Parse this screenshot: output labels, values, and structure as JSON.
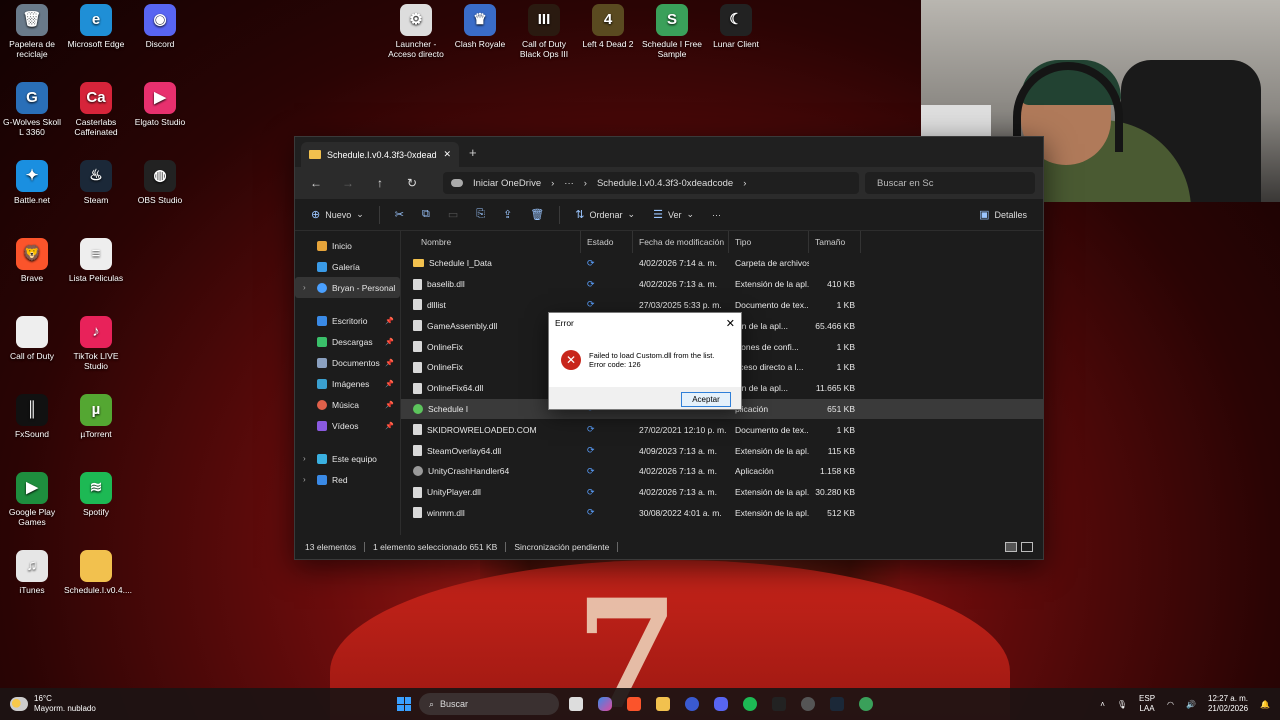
{
  "desktop_icons": [
    {
      "label": "Papelera de reciclaje",
      "color": "#6a7a8a",
      "glyph": "🗑"
    },
    {
      "label": "Microsoft Edge",
      "color": "#1f8fd6",
      "glyph": "e"
    },
    {
      "label": "Discord",
      "color": "#5865f2",
      "glyph": "◉"
    },
    {
      "label": "G-Wolves Skoll L 3360",
      "color": "#2a6fb8",
      "glyph": "G"
    },
    {
      "label": "Casterlabs Caffeinated",
      "color": "#d6243a",
      "glyph": "Ca"
    },
    {
      "label": "Elgato Studio",
      "color": "#e8306e",
      "glyph": "▶"
    },
    {
      "label": "Battle.net",
      "color": "#1a8fe0",
      "glyph": "✦"
    },
    {
      "label": "Steam",
      "color": "#1b2838",
      "glyph": "♨"
    },
    {
      "label": "OBS Studio",
      "color": "#222",
      "glyph": "◍"
    },
    {
      "label": "Brave",
      "color": "#fb542b",
      "glyph": "🦁"
    },
    {
      "label": "Lista Peliculas",
      "color": "#eee",
      "glyph": "≡"
    },
    {
      "label": "Call of Duty",
      "color": "#eee",
      "glyph": ""
    },
    {
      "label": "TikTok LIVE Studio",
      "color": "#e8225a",
      "glyph": "♪"
    },
    {
      "label": "FxSound",
      "color": "#111",
      "glyph": "║"
    },
    {
      "label": "µTorrent",
      "color": "#54a732",
      "glyph": "µ"
    },
    {
      "label": "Google Play Games",
      "color": "#1e8e3e",
      "glyph": "▶"
    },
    {
      "label": "Spotify",
      "color": "#1db954",
      "glyph": "≋"
    },
    {
      "label": "iTunes",
      "color": "#e6e6e6",
      "glyph": "♫"
    },
    {
      "label": "Schedule.I.v0.4....",
      "color": "#f2c14e",
      "glyph": ""
    },
    {
      "label": "Launcher - Acceso directo",
      "color": "#ddd",
      "glyph": "⚙"
    },
    {
      "label": "Clash Royale",
      "color": "#3a6cc8",
      "glyph": "♛"
    },
    {
      "label": "Call of Duty Black Ops III",
      "color": "#2a1a10",
      "glyph": "III"
    },
    {
      "label": "Left 4 Dead 2",
      "color": "#5a4a20",
      "glyph": "4"
    },
    {
      "label": "Schedule I Free Sample",
      "color": "#3aa05a",
      "glyph": "S"
    },
    {
      "label": "Lunar Client",
      "color": "#222",
      "glyph": "☾"
    }
  ],
  "explorer": {
    "tab_title": "Schedule.I.v0.4.3f3-0xdeadcode",
    "breadcrumb_root": "Iniciar OneDrive",
    "breadcrumb_ellipsis": "···",
    "breadcrumb_current": "Schedule.I.v0.4.3f3-0xdeadcode",
    "search_placeholder": "Buscar en Sc",
    "toolbar": {
      "new_label": "Nuevo",
      "sort_label": "Ordenar",
      "view_label": "Ver",
      "more_label": "···",
      "details_label": "Detalles"
    },
    "nav": {
      "home": "Inicio",
      "gallery": "Galería",
      "onedrive": "Bryan - Personal",
      "desktop": "Escritorio",
      "downloads": "Descargas",
      "documents": "Documentos",
      "images": "Imágenes",
      "music": "Música",
      "videos": "Vídeos",
      "this_pc": "Este equipo",
      "network": "Red"
    },
    "columns": {
      "name": "Nombre",
      "state": "Estado",
      "date": "Fecha de modificación",
      "type": "Tipo",
      "size": "Tamaño"
    },
    "files": [
      {
        "name": "Schedule I_Data",
        "kind": "folder",
        "date": "4/02/2026 7:14 a. m.",
        "type": "Carpeta de archivos",
        "size": ""
      },
      {
        "name": "baselib.dll",
        "kind": "file",
        "date": "4/02/2026 7:13 a. m.",
        "type": "Extensión de la apl...",
        "size": "410 KB"
      },
      {
        "name": "dlllist",
        "kind": "file",
        "date": "27/03/2025 5:33 p. m.",
        "type": "Documento de tex...",
        "size": "1 KB"
      },
      {
        "name": "GameAssembly.dll",
        "kind": "file",
        "date": "",
        "type": "ión de la apl...",
        "size": "65.466 KB"
      },
      {
        "name": "OnlineFix",
        "kind": "file",
        "date": "",
        "type": "ciones de confi...",
        "size": "1 KB"
      },
      {
        "name": "OnlineFix",
        "kind": "file",
        "date": "",
        "type": "cceso directo a l...",
        "size": "1 KB"
      },
      {
        "name": "OnlineFix64.dll",
        "kind": "file",
        "date": "",
        "type": "ión de la apl...",
        "size": "11.665 KB"
      },
      {
        "name": "Schedule I",
        "kind": "app",
        "date": "",
        "type": "plicación",
        "size": "651 KB"
      },
      {
        "name": "SKIDROWRELOADED.COM",
        "kind": "file",
        "date": "27/02/2021 12:10 p. m.",
        "type": "Documento de tex...",
        "size": "1 KB"
      },
      {
        "name": "SteamOverlay64.dll",
        "kind": "file",
        "date": "4/09/2023 7:13 a. m.",
        "type": "Extensión de la apl...",
        "size": "115 KB"
      },
      {
        "name": "UnityCrashHandler64",
        "kind": "gear",
        "date": "4/02/2026 7:13 a. m.",
        "type": "Aplicación",
        "size": "1.158 KB"
      },
      {
        "name": "UnityPlayer.dll",
        "kind": "file",
        "date": "4/02/2026 7:13 a. m.",
        "type": "Extensión de la apl...",
        "size": "30.280 KB"
      },
      {
        "name": "winmm.dll",
        "kind": "file",
        "date": "30/08/2022 4:01 a. m.",
        "type": "Extensión de la apl...",
        "size": "512 KB"
      }
    ],
    "status": {
      "count": "13 elementos",
      "selected": "1 elemento seleccionado  651 KB",
      "sync": "Sincronización pendiente"
    }
  },
  "dialog": {
    "title": "Error",
    "message_line1": "Failed to load Custom.dll from the list.",
    "message_line2": "Error code: 126",
    "ok_label": "Aceptar"
  },
  "taskbar": {
    "temp": "16°C",
    "weather": "Mayorm. nublado",
    "search_label": "Buscar",
    "lang_top": "ESP",
    "lang_bottom": "LAA",
    "time": "12:27 a. m.",
    "date": "21/02/2026"
  }
}
